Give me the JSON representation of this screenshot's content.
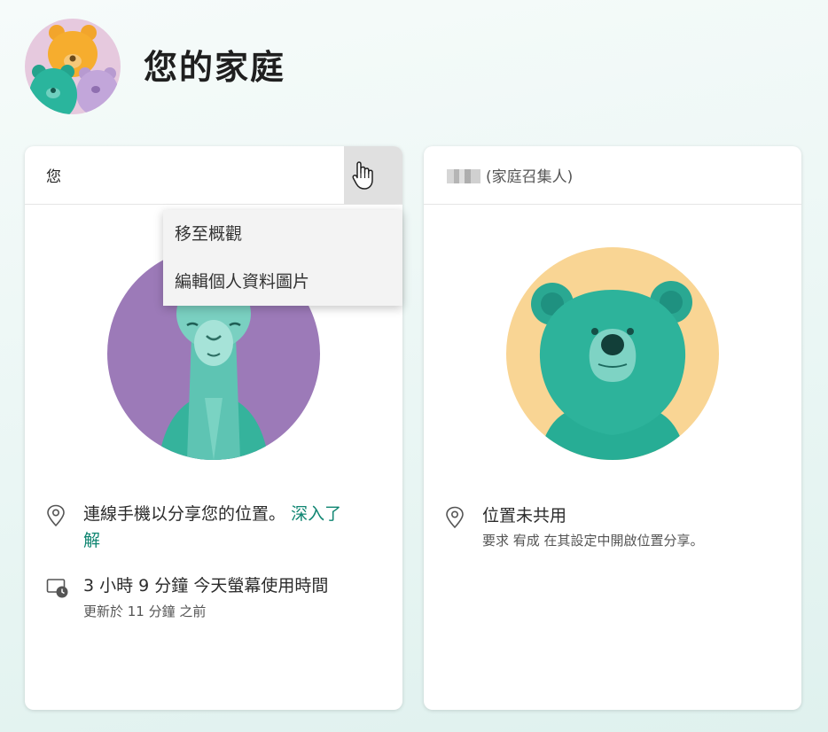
{
  "header": {
    "title": "您的家庭"
  },
  "members": [
    {
      "name": "您",
      "menu": {
        "items": [
          "移至概觀",
          "編輯個人資料圖片"
        ]
      },
      "location": {
        "text": "連線手機以分享您的位置。",
        "link": "深入了",
        "link_cont": "解"
      },
      "screen_time": {
        "text": "3 小時 9 分鐘 今天螢幕使用時間",
        "updated": "更新於 11 分鐘 之前"
      }
    },
    {
      "name_suffix": "(家庭召集人)",
      "location": {
        "text": "位置未共用",
        "sub": "要求 宥成 在其設定中開啟位置分享。"
      }
    }
  ],
  "colors": {
    "accent": "#0f8571",
    "teal": "#2bb39c",
    "purple": "#9c7ab8",
    "yellow": "#f9d594"
  },
  "icons": [
    "family-avatar",
    "more-options-icon",
    "hand-cursor-icon",
    "location-pin-icon",
    "screen-time-icon"
  ]
}
